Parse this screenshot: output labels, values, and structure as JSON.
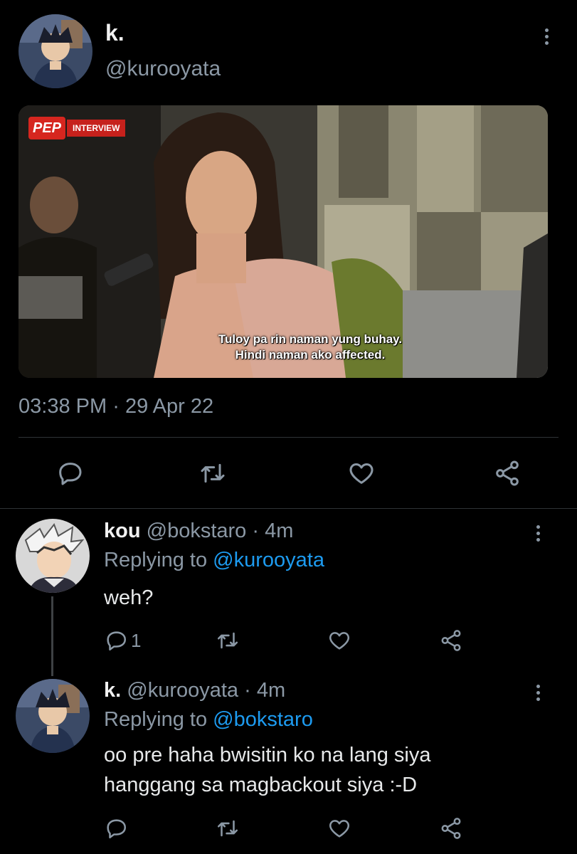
{
  "main_tweet": {
    "author_name": "k.",
    "author_handle": "@kurooyata",
    "media": {
      "source_badge": "PEP",
      "badge_label": "INTERVIEW",
      "caption_line_1": "Tuloy pa rin naman yung buhay.",
      "caption_line_2": "Hindi naman ako affected."
    },
    "time": "03:38 PM",
    "separator": "·",
    "date": "29 Apr 22",
    "actions": {
      "reply_icon": "reply-icon",
      "retweet_icon": "retweet-icon",
      "like_icon": "heart-icon",
      "share_icon": "share-icon"
    }
  },
  "replies": [
    {
      "name": "kou",
      "handle": "@bokstaro",
      "sep": "·",
      "age": "4m",
      "replying_prefix": "Replying to",
      "replying_to": "@kurooyata",
      "text_lines": [
        "weh?"
      ],
      "reply_count": "1"
    },
    {
      "name": "k.",
      "handle": "@kurooyata",
      "sep": "·",
      "age": "4m",
      "replying_prefix": "Replying to",
      "replying_to": "@bokstaro",
      "text_lines": [
        "oo pre haha bwisitin ko na lang siya",
        "hanggang sa magbackout siya :-D"
      ],
      "reply_count": ""
    }
  ],
  "colors": {
    "background": "#000000",
    "text": "#e7e9ea",
    "muted": "#8b98a5",
    "link": "#1d9bf0",
    "divider": "#2f3336"
  }
}
